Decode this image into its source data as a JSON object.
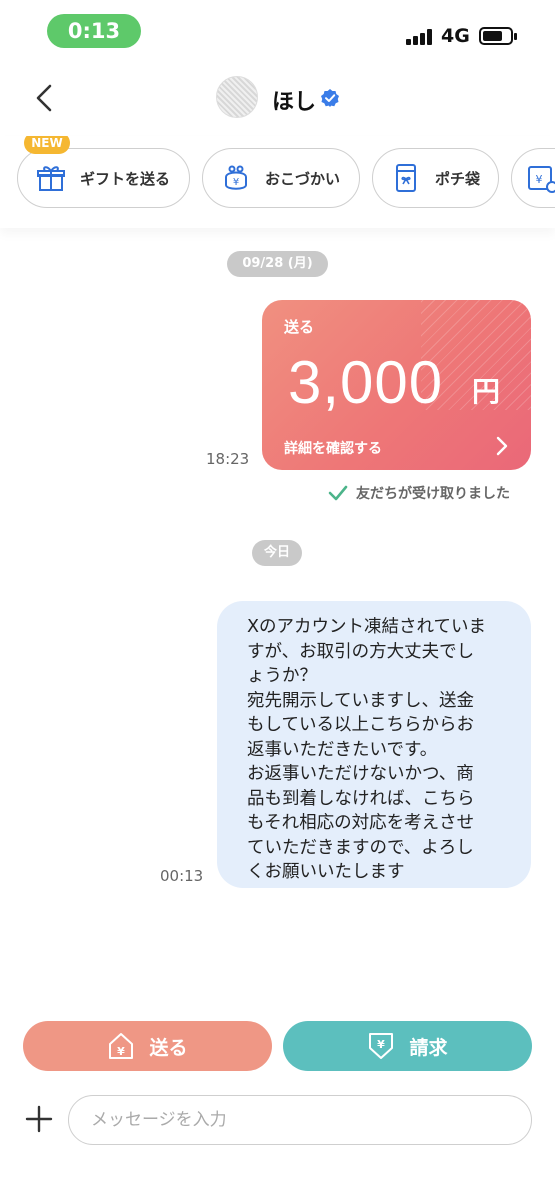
{
  "status_bar": {
    "time": "0:13",
    "network": "4G",
    "icons": [
      "signal-icon",
      "battery-icon"
    ]
  },
  "header": {
    "contact_name": "ほし",
    "icons": [
      "back-icon",
      "avatar",
      "verified-icon"
    ]
  },
  "actions": [
    {
      "label": "ギフトを送る",
      "icon": "gift-icon",
      "badge": "NEW"
    },
    {
      "label": "おこづかい",
      "icon": "coin-purse-icon"
    },
    {
      "label": "ポチ袋",
      "icon": "envelope-icon"
    },
    {
      "label": "",
      "icon": "request-card-icon"
    }
  ],
  "chat": {
    "date_1": "09/28 (月)",
    "payment": {
      "type": "送る",
      "amount": "3,000",
      "currency": "円",
      "detail_link": "詳細を確認する",
      "time": "18:23",
      "status": "友だちが受け取りました"
    },
    "date_2": "今日",
    "message": {
      "lines": [
        "Xのアカウント凍結されていま",
        "すが、お取引の方大丈夫でし",
        "ょうか？",
        "宛先開示していますし、送金",
        "もしている以上こちらからお",
        "返事いただきたいです。",
        "お返事いただけないかつ、商",
        "品も到着しなければ、こちら",
        "もそれ相応の対応を考えさせ",
        "ていただきますので、よろし",
        "くお願いいたします"
      ],
      "time": "00:13"
    }
  },
  "bottom": {
    "send_label": "送る",
    "request_label": "請求",
    "input_placeholder": "メッセージを入力"
  },
  "colors": {
    "status_green": "#5ec96a",
    "pay_card": "#ee7777",
    "send_button": "#ef9785",
    "request_button": "#5cbfbe",
    "bubble": "#e4eefb",
    "badge": "#f5b731",
    "verified": "#3b7de8"
  }
}
